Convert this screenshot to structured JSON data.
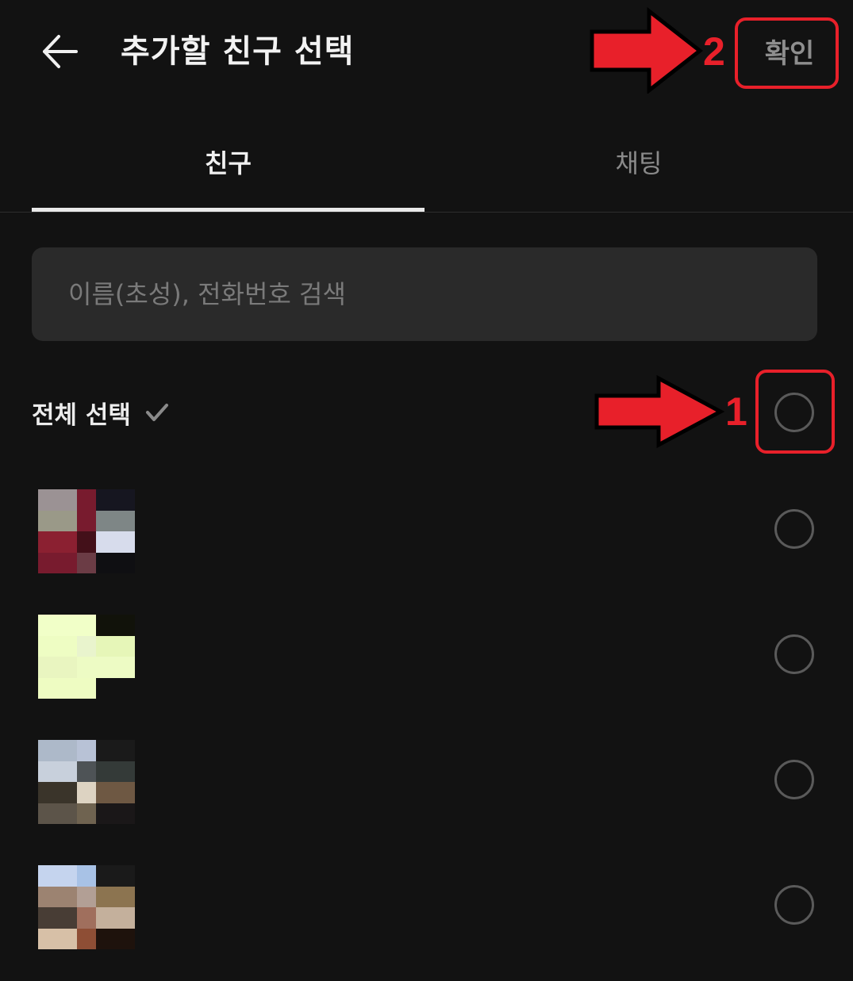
{
  "header": {
    "back_icon": "arrow-left-icon",
    "title": "추가할 친구 선택",
    "confirm_label": "확인"
  },
  "tabs": [
    {
      "label": "친구",
      "active": true
    },
    {
      "label": "채팅",
      "active": false
    }
  ],
  "search": {
    "placeholder": "이름(초성), 전화번호 검색",
    "value": ""
  },
  "select_all": {
    "label": "전체 선택",
    "icon": "check-icon",
    "checked": false
  },
  "friends": [
    {
      "avatar_colors": [
        "#9b9294",
        "#781b2e",
        "#161620",
        "#9a9988",
        "#781b2e",
        "#7e8686",
        "#8b2031",
        "#431019",
        "#d7dcec",
        "#781b2e",
        "#6b3c45",
        "#0f0f12"
      ]
    },
    {
      "avatar_colors": [
        "#f1ffc8",
        "#f1ffc8",
        "#11120a",
        "#eefdc3",
        "#e9f4cd",
        "#e6f6b8",
        "#e9f5c0",
        "#edfbc4",
        "#edfbc4",
        "#eefcc2",
        "#eefcc2",
        "#121212"
      ]
    },
    {
      "avatar_colors": [
        "#adb9c9",
        "#b8c2d6",
        "#1a1a1a",
        "#c8d0dc",
        "#4e5356",
        "#343a38",
        "#3a342a",
        "#ddd3c2",
        "#6e5843",
        "#5c5449",
        "#6f6350",
        "#1a1718"
      ]
    },
    {
      "avatar_colors": [
        "#c5d4ee",
        "#a8c2e6",
        "#1a1a1a",
        "#9c8371",
        "#b29f95",
        "#8c7450",
        "#483d35",
        "#a06f5d",
        "#c4b09c",
        "#d7c0a7",
        "#8e4e35",
        "#1e120c"
      ]
    }
  ],
  "annotations": [
    {
      "number": "1",
      "target": "select-all-radio"
    },
    {
      "number": "2",
      "target": "confirm-button"
    }
  ],
  "colors": {
    "background": "#121212",
    "annotation_red": "#e8202a",
    "search_bg": "#2a2a2a",
    "radio_border": "#5a5a5a"
  }
}
